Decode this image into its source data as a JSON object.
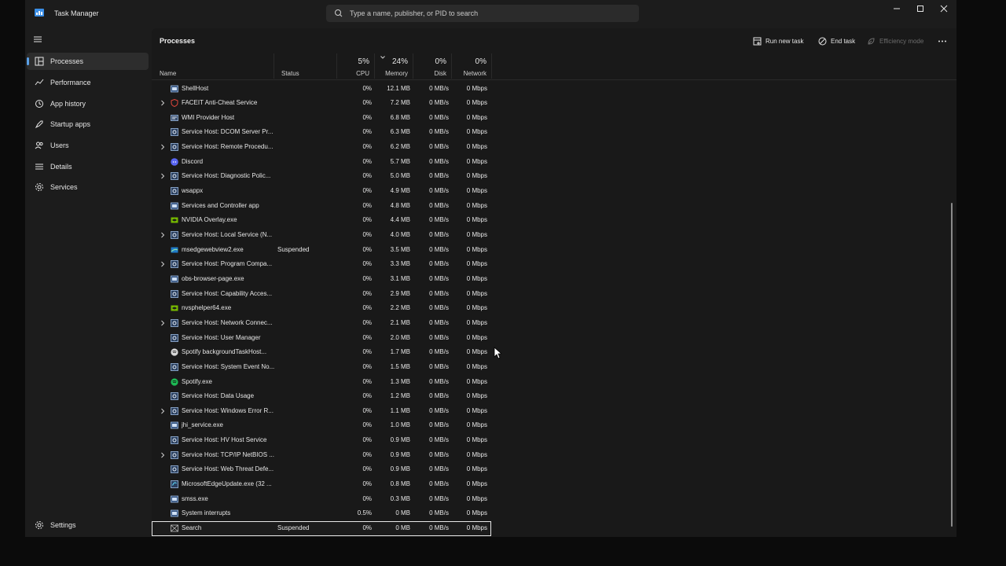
{
  "app": {
    "title": "Task Manager"
  },
  "search": {
    "placeholder": "Type a name, publisher, or PID to search"
  },
  "sidebar": {
    "items": [
      {
        "label": "Processes",
        "icon": "processes-icon",
        "active": true
      },
      {
        "label": "Performance",
        "icon": "performance-icon"
      },
      {
        "label": "App history",
        "icon": "history-icon"
      },
      {
        "label": "Startup apps",
        "icon": "startup-icon"
      },
      {
        "label": "Users",
        "icon": "users-icon"
      },
      {
        "label": "Details",
        "icon": "details-icon"
      },
      {
        "label": "Services",
        "icon": "services-icon"
      }
    ],
    "settings_label": "Settings"
  },
  "toolbar": {
    "title": "Processes",
    "run_new_task": "Run new task",
    "end_task": "End task",
    "efficiency_mode": "Efficiency mode"
  },
  "columns": {
    "name": "Name",
    "status": "Status",
    "cpu": {
      "percent": "5%",
      "label": "CPU"
    },
    "memory": {
      "percent": "24%",
      "label": "Memory"
    },
    "disk": {
      "percent": "0%",
      "label": "Disk"
    },
    "network": {
      "percent": "0%",
      "label": "Network"
    }
  },
  "processes": [
    {
      "name": "ShellHost",
      "status": "",
      "cpu": "0%",
      "memory": "12.1 MB",
      "disk": "0 MB/s",
      "network": "0 Mbps",
      "expandable": false,
      "icon": "app-window-icon"
    },
    {
      "name": "FACEIT Anti-Cheat Service",
      "status": "",
      "cpu": "0%",
      "memory": "7.2 MB",
      "disk": "0 MB/s",
      "network": "0 Mbps",
      "expandable": true,
      "icon": "faceit-shield-icon"
    },
    {
      "name": "WMI Provider Host",
      "status": "",
      "cpu": "0%",
      "memory": "6.8 MB",
      "disk": "0 MB/s",
      "network": "0 Mbps",
      "expandable": false,
      "icon": "wmi-icon"
    },
    {
      "name": "Service Host: DCOM Server Pr...",
      "status": "",
      "cpu": "0%",
      "memory": "6.3 MB",
      "disk": "0 MB/s",
      "network": "0 Mbps",
      "expandable": false,
      "icon": "service-gear-icon"
    },
    {
      "name": "Service Host: Remote Procedu...",
      "status": "",
      "cpu": "0%",
      "memory": "6.2 MB",
      "disk": "0 MB/s",
      "network": "0 Mbps",
      "expandable": true,
      "icon": "service-gear-icon"
    },
    {
      "name": "Discord",
      "status": "",
      "cpu": "0%",
      "memory": "5.7 MB",
      "disk": "0 MB/s",
      "network": "0 Mbps",
      "expandable": false,
      "icon": "discord-icon"
    },
    {
      "name": "Service Host: Diagnostic Polic...",
      "status": "",
      "cpu": "0%",
      "memory": "5.0 MB",
      "disk": "0 MB/s",
      "network": "0 Mbps",
      "expandable": true,
      "icon": "service-gear-icon"
    },
    {
      "name": "wsappx",
      "status": "",
      "cpu": "0%",
      "memory": "4.9 MB",
      "disk": "0 MB/s",
      "network": "0 Mbps",
      "expandable": false,
      "icon": "service-gear-icon"
    },
    {
      "name": "Services and Controller app",
      "status": "",
      "cpu": "0%",
      "memory": "4.8 MB",
      "disk": "0 MB/s",
      "network": "0 Mbps",
      "expandable": false,
      "icon": "app-window-icon"
    },
    {
      "name": "NVIDIA Overlay.exe",
      "status": "",
      "cpu": "0%",
      "memory": "4.4 MB",
      "disk": "0 MB/s",
      "network": "0 Mbps",
      "expandable": false,
      "icon": "nvidia-icon"
    },
    {
      "name": "Service Host: Local Service (N...",
      "status": "",
      "cpu": "0%",
      "memory": "4.0 MB",
      "disk": "0 MB/s",
      "network": "0 Mbps",
      "expandable": true,
      "icon": "service-gear-icon"
    },
    {
      "name": "msedgewebview2.exe",
      "status": "Suspended",
      "cpu": "0%",
      "memory": "3.5 MB",
      "disk": "0 MB/s",
      "network": "0 Mbps",
      "expandable": false,
      "icon": "edge-webview-icon"
    },
    {
      "name": "Service Host: Program Compa...",
      "status": "",
      "cpu": "0%",
      "memory": "3.3 MB",
      "disk": "0 MB/s",
      "network": "0 Mbps",
      "expandable": true,
      "icon": "service-gear-icon"
    },
    {
      "name": "obs-browser-page.exe",
      "status": "",
      "cpu": "0%",
      "memory": "3.1 MB",
      "disk": "0 MB/s",
      "network": "0 Mbps",
      "expandable": false,
      "icon": "app-window-icon"
    },
    {
      "name": "Service Host: Capability Acces...",
      "status": "",
      "cpu": "0%",
      "memory": "2.9 MB",
      "disk": "0 MB/s",
      "network": "0 Mbps",
      "expandable": false,
      "icon": "service-gear-icon"
    },
    {
      "name": "nvsphelper64.exe",
      "status": "",
      "cpu": "0%",
      "memory": "2.2 MB",
      "disk": "0 MB/s",
      "network": "0 Mbps",
      "expandable": false,
      "icon": "nvidia-icon"
    },
    {
      "name": "Service Host: Network Connec...",
      "status": "",
      "cpu": "0%",
      "memory": "2.1 MB",
      "disk": "0 MB/s",
      "network": "0 Mbps",
      "expandable": true,
      "icon": "service-gear-icon"
    },
    {
      "name": "Service Host: User Manager",
      "status": "",
      "cpu": "0%",
      "memory": "2.0 MB",
      "disk": "0 MB/s",
      "network": "0 Mbps",
      "expandable": false,
      "icon": "service-gear-icon"
    },
    {
      "name": "Spotify backgroundTaskHost...",
      "status": "",
      "cpu": "0%",
      "memory": "1.7 MB",
      "disk": "0 MB/s",
      "network": "0 Mbps",
      "expandable": false,
      "icon": "spotify-gray-icon"
    },
    {
      "name": "Service Host: System Event No...",
      "status": "",
      "cpu": "0%",
      "memory": "1.5 MB",
      "disk": "0 MB/s",
      "network": "0 Mbps",
      "expandable": false,
      "icon": "service-gear-icon"
    },
    {
      "name": "Spotify.exe",
      "status": "",
      "cpu": "0%",
      "memory": "1.3 MB",
      "disk": "0 MB/s",
      "network": "0 Mbps",
      "expandable": false,
      "icon": "spotify-icon"
    },
    {
      "name": "Service Host: Data Usage",
      "status": "",
      "cpu": "0%",
      "memory": "1.2 MB",
      "disk": "0 MB/s",
      "network": "0 Mbps",
      "expandable": false,
      "icon": "service-gear-icon"
    },
    {
      "name": "Service Host: Windows Error R...",
      "status": "",
      "cpu": "0%",
      "memory": "1.1 MB",
      "disk": "0 MB/s",
      "network": "0 Mbps",
      "expandable": true,
      "icon": "service-gear-icon"
    },
    {
      "name": "jhi_service.exe",
      "status": "",
      "cpu": "0%",
      "memory": "1.0 MB",
      "disk": "0 MB/s",
      "network": "0 Mbps",
      "expandable": false,
      "icon": "app-window-icon"
    },
    {
      "name": "Service Host: HV Host Service",
      "status": "",
      "cpu": "0%",
      "memory": "0.9 MB",
      "disk": "0 MB/s",
      "network": "0 Mbps",
      "expandable": false,
      "icon": "service-gear-icon"
    },
    {
      "name": "Service Host: TCP/IP NetBIOS ...",
      "status": "",
      "cpu": "0%",
      "memory": "0.9 MB",
      "disk": "0 MB/s",
      "network": "0 Mbps",
      "expandable": true,
      "icon": "service-gear-icon"
    },
    {
      "name": "Service Host: Web Threat Defe...",
      "status": "",
      "cpu": "0%",
      "memory": "0.9 MB",
      "disk": "0 MB/s",
      "network": "0 Mbps",
      "expandable": false,
      "icon": "service-gear-icon"
    },
    {
      "name": "MicrosoftEdgeUpdate.exe (32 ...",
      "status": "",
      "cpu": "0%",
      "memory": "0.8 MB",
      "disk": "0 MB/s",
      "network": "0 Mbps",
      "expandable": false,
      "icon": "edge-update-icon"
    },
    {
      "name": "smss.exe",
      "status": "",
      "cpu": "0%",
      "memory": "0.3 MB",
      "disk": "0 MB/s",
      "network": "0 Mbps",
      "expandable": false,
      "icon": "app-window-icon"
    },
    {
      "name": "System interrupts",
      "status": "",
      "cpu": "0.5%",
      "memory": "0 MB",
      "disk": "0 MB/s",
      "network": "0 Mbps",
      "expandable": false,
      "icon": "app-window-icon"
    },
    {
      "name": "Search",
      "status": "Suspended",
      "cpu": "0%",
      "memory": "0 MB",
      "disk": "0 MB/s",
      "network": "0 Mbps",
      "expandable": false,
      "icon": "search-app-icon",
      "selected": true
    }
  ],
  "colors": {
    "accent": "#5aa0e6",
    "window_bg": "#1c1c1c",
    "content_bg": "#191919",
    "text": "#e6e6e6"
  }
}
